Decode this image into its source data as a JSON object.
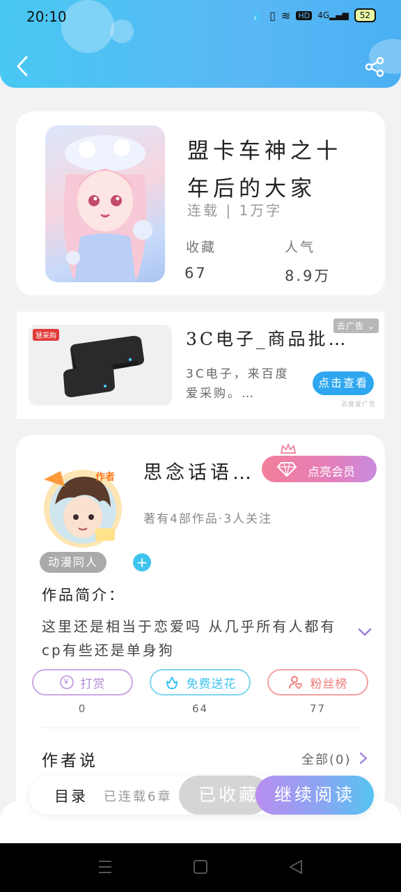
{
  "status_bar": {
    "time": "20:10",
    "battery": "52"
  },
  "book": {
    "title": "盟卡车神之十年后的大家",
    "meta": "连载 | 1万字",
    "stats": [
      {
        "label": "收藏",
        "value": "67"
      },
      {
        "label": "人气",
        "value": "8.9万"
      }
    ]
  },
  "ad": {
    "brand_tag": "慧采购",
    "title": "3C电子_商品批…",
    "description": "3C电子，来百度爱采购。…",
    "close_label": "去广告",
    "cta_label": "点击查看",
    "source": "百度爱广告"
  },
  "author": {
    "avatar_badge": "作者",
    "name": "思念话语…",
    "vip_label": "点亮会员",
    "subtitle": "著有4部作品·3人关注",
    "tag": "动漫同人",
    "intro_title": "作品简介：",
    "intro_text": "这里还是相当于恋爱吗 从几乎所有人都有cp有些还是单身狗",
    "actions": [
      {
        "label": "打赏",
        "count": "0",
        "color": "#b38ad6"
      },
      {
        "label": "免费送花",
        "count": "64",
        "color": "#3ec3ef"
      },
      {
        "label": "粉丝榜",
        "count": "77",
        "color": "#ef7a7a"
      }
    ],
    "says_title": "作者说",
    "says_all": "全部(0)"
  },
  "bottom": {
    "toc_label": "目录",
    "serial_label": "已连载6章",
    "collected_label": "已收藏",
    "continue_label": "继续阅读"
  }
}
